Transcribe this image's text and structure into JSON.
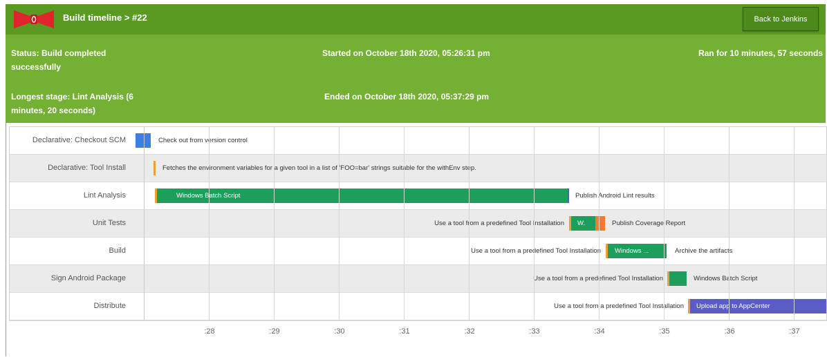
{
  "header": {
    "breadcrumb": "Build timeline > #22",
    "back_button": "Back to Jenkins",
    "background": "#5a9a23"
  },
  "summary": {
    "status": "Status: Build completed successfully",
    "longest_stage": "Longest stage: Lint Analysis (6 minutes, 20 seconds)",
    "started": "Started on October 18th 2020, 05:26:31 pm",
    "ended": "Ended on October 18th 2020, 05:37:29 pm",
    "ran_for": "Ran for 10 minutes, 57 seconds",
    "background": "#73b033"
  },
  "stages": [
    {
      "name": "Declarative: Checkout SCM",
      "after_text": "Check out from version control"
    },
    {
      "name": "Declarative: Tool Install",
      "after_text": "Fetches the environment variables for a given tool in a list of 'FOO=bar' strings suitable for the withEnv step."
    },
    {
      "name": "Lint Analysis",
      "bar_text": "Windows Batch Script",
      "after_text": "Publish Android Lint results"
    },
    {
      "name": "Unit Tests",
      "before_text": "Use a tool from a predefined Tool Installation",
      "bar_text": "W.",
      "after_text": "Publish Coverage Report"
    },
    {
      "name": "Build",
      "before_text": "Use a tool from a predefined Tool Installation",
      "bar_text": "Windows ...",
      "after_text": "Archive the artifacts"
    },
    {
      "name": "Sign Android Package",
      "before_text": "Use a tool from a predefined Tool Installation",
      "bar_text": "",
      "after_text": "Windows Batch Script"
    },
    {
      "name": "Distribute",
      "before_text": "Use a tool from a predefined Tool Installation",
      "bar_text": "Upload app to AppCenter"
    }
  ],
  "axis": {
    "ticks": [
      ":28",
      ":29",
      ":30",
      ":31",
      ":32",
      ":33",
      ":34",
      ":35",
      ":36",
      ":37"
    ]
  },
  "colors": {
    "step_green": "#1d9e5a",
    "step_blue": "#3f7fe4",
    "step_purple": "#5b5cc6",
    "step_orange": "#ef7b35",
    "step_edge": "#f0a030"
  }
}
